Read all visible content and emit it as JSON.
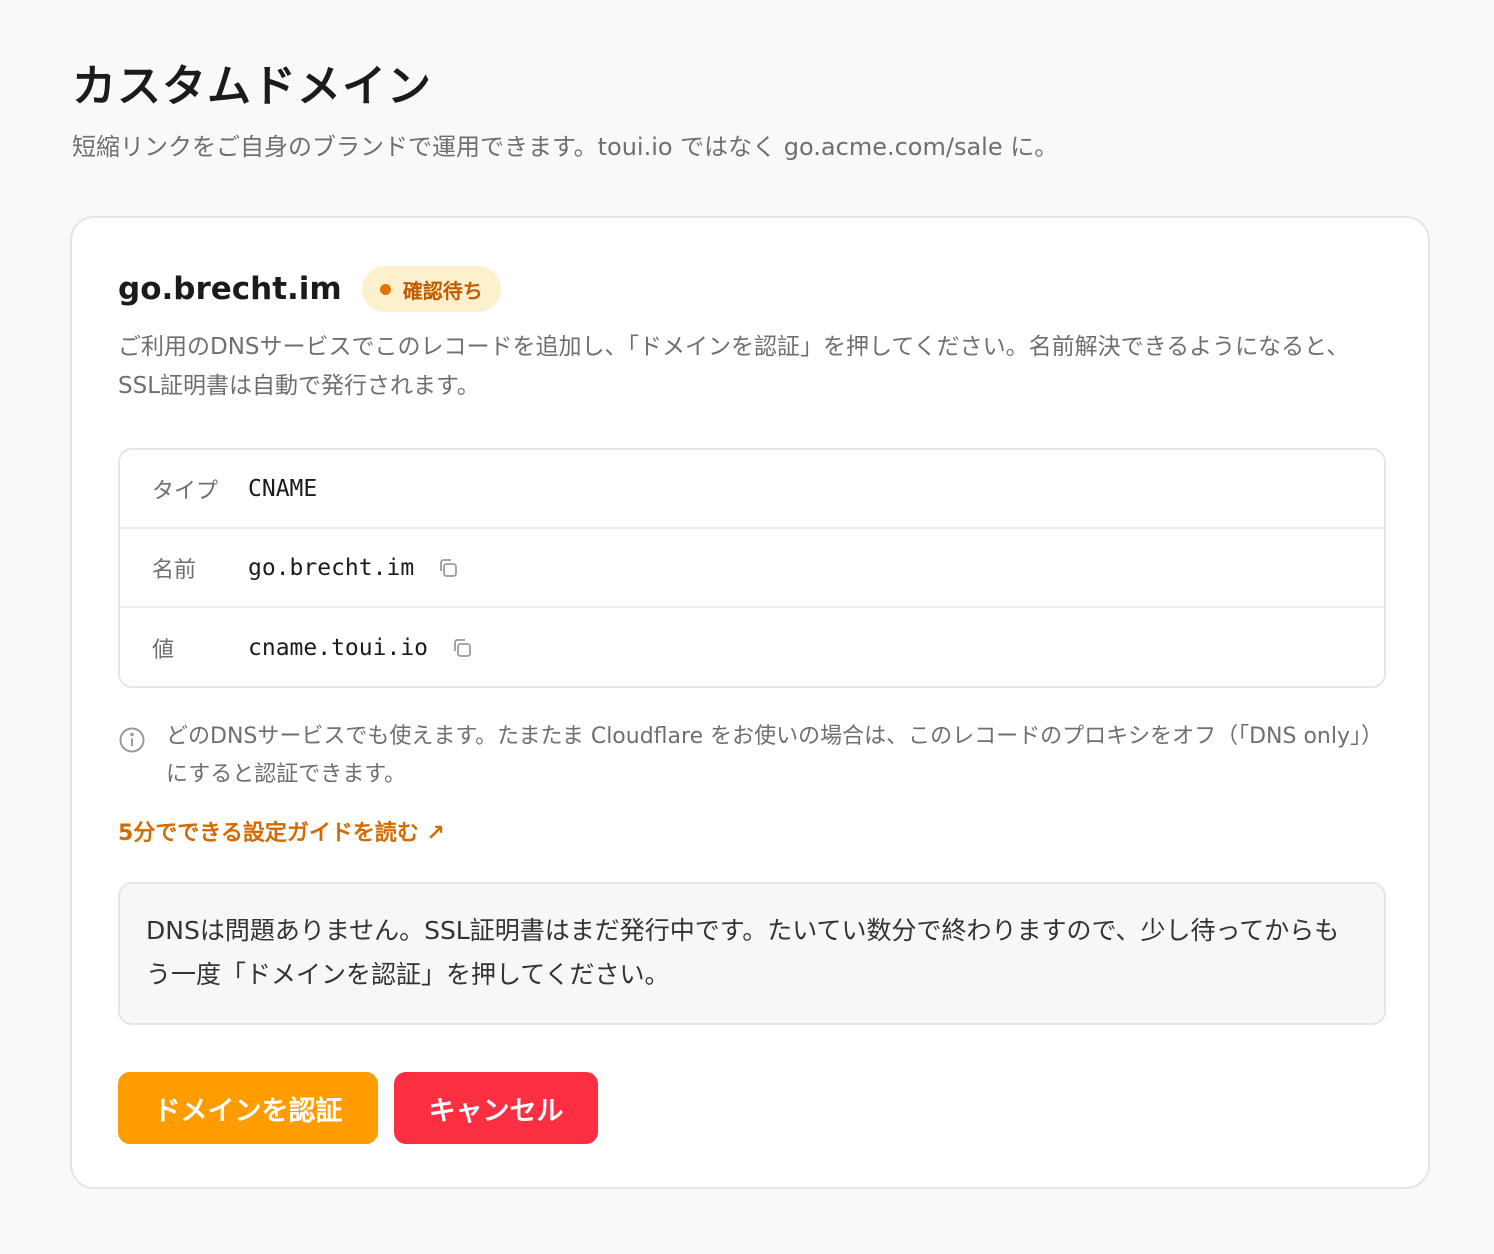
{
  "header": {
    "title": "カスタムドメイン",
    "subtitle": "短縮リンクをご自身のブランドで運用できます。toui.io ではなく go.acme.com/sale に。"
  },
  "domain": {
    "name": "go.brecht.im",
    "status": "確認待ち",
    "description": "ご利用のDNSサービスでこのレコードを追加し、「ドメインを認証」を押してください。名前解決できるようになると、SSL証明書は自動で発行されます。"
  },
  "records": [
    {
      "label": "タイプ",
      "value": "CNAME"
    },
    {
      "label": "名前",
      "value": "go.brecht.im"
    },
    {
      "label": "値",
      "value": "cname.toui.io"
    }
  ],
  "note": {
    "text": "どのDNSサービスでも使えます。たまたま Cloudflare をお使いの場合は、このレコードのプロキシをオフ（「DNS only」）にすると認証できます。"
  },
  "guide_link": {
    "text": "5分でできる設定ガイドを読む ↗"
  },
  "status_message": "DNSは問題ありません。SSL証明書はまだ発行中です。たいてい数分で終わりますので、少し待ってからもう一度「ドメインを認証」を押してください。",
  "actions": {
    "verify": "ドメインを認証",
    "cancel": "キャンセル"
  },
  "colors": {
    "accent": "#ff9d00",
    "danger": "#fb2e42",
    "badge_bg": "#fdf0cc",
    "badge_text": "#c25b00",
    "link": "#d46a00"
  }
}
